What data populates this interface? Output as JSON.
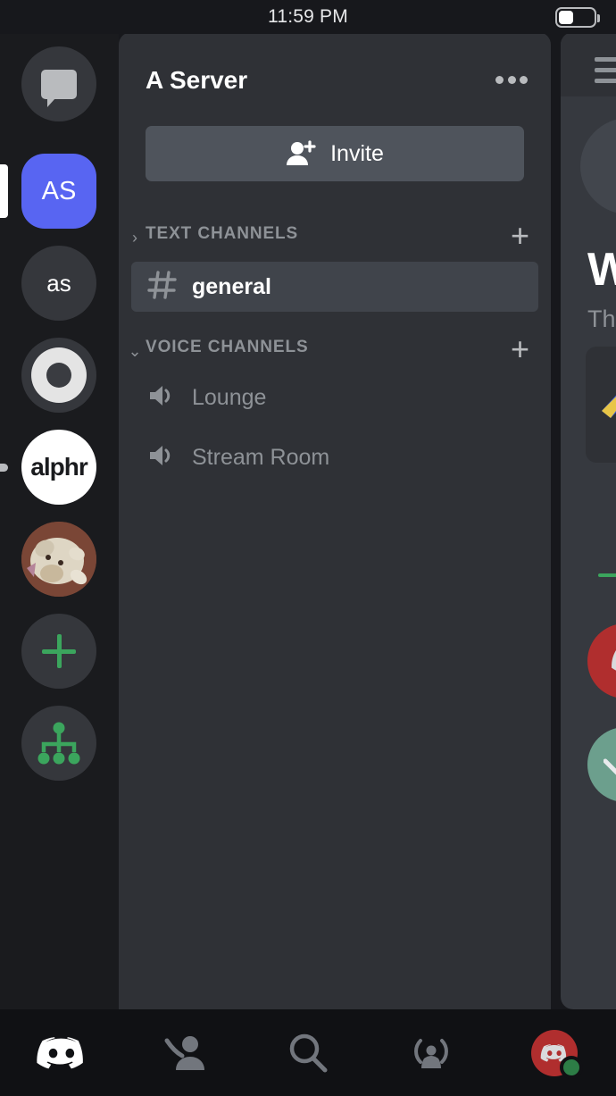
{
  "status_bar": {
    "time": "11:59 PM",
    "battery_icon": "battery-icon",
    "battery_level_percent": 38
  },
  "chat_panel": {
    "menu_icon": "hamburger-menu-icon",
    "welcome_heading": "W",
    "welcome_subtitle": "Th",
    "divider_color": "#3ba55d",
    "message_avatars": [
      "red-discord-avatar",
      "teal-avatar"
    ]
  },
  "server_rail": {
    "items": [
      {
        "name": "direct-messages",
        "type": "dm",
        "label": "",
        "icon": "chat-bubble-icon",
        "indicator": "none",
        "bg": "#35373c"
      },
      {
        "name": "server-as-active",
        "type": "text-squircle",
        "label": "AS",
        "icon": "",
        "indicator": "active",
        "bg": "#5865f2"
      },
      {
        "name": "server-as-lower",
        "type": "text",
        "label": "as",
        "icon": "",
        "indicator": "none",
        "bg": "#35373c"
      },
      {
        "name": "server-donut",
        "type": "donut",
        "label": "",
        "icon": "donut-logo-icon",
        "indicator": "none",
        "bg": "#35373c"
      },
      {
        "name": "server-alphr",
        "type": "white",
        "label": "alphr",
        "icon": "",
        "indicator": "unread",
        "bg": "#ffffff"
      },
      {
        "name": "server-dog-photo",
        "type": "photo",
        "label": "",
        "icon": "dog-photo-avatar",
        "indicator": "none",
        "bg": "#6b3f33"
      },
      {
        "name": "add-a-server",
        "type": "plus",
        "label": "",
        "icon": "plus-icon",
        "indicator": "none",
        "bg": "#35373c"
      },
      {
        "name": "explore-servers",
        "type": "explore",
        "label": "",
        "icon": "server-discovery-icon",
        "indicator": "none",
        "bg": "#35373c"
      }
    ],
    "accent_green": "#3ba55d",
    "blurple": "#5865f2"
  },
  "channel_panel": {
    "server_name": "A Server",
    "more_options_icon": "more-options-icon",
    "invite": {
      "label": "Invite",
      "icon": "person-add-icon"
    },
    "categories": [
      {
        "name": "TEXT CHANNELS",
        "chevron": "chevron-right-icon",
        "expanded": false,
        "add_icon": "plus-icon",
        "channels": [
          {
            "name": "general",
            "icon": "hash-icon",
            "active": true
          }
        ]
      },
      {
        "name": "VOICE CHANNELS",
        "chevron": "chevron-down-icon",
        "expanded": true,
        "add_icon": "plus-icon",
        "channels": [
          {
            "name": "Lounge",
            "icon": "speaker-icon",
            "active": false
          },
          {
            "name": "Stream Room",
            "icon": "speaker-icon",
            "active": false
          }
        ]
      }
    ]
  },
  "bottom_nav": {
    "items": [
      {
        "name": "nav-home",
        "icon": "discord-logo-icon",
        "active": true
      },
      {
        "name": "nav-friends",
        "icon": "friends-icon",
        "active": false
      },
      {
        "name": "nav-search",
        "icon": "search-icon",
        "active": false
      },
      {
        "name": "nav-mentions",
        "icon": "mentions-icon",
        "active": false
      },
      {
        "name": "nav-profile",
        "icon": "user-avatar-icon",
        "active": false
      }
    ],
    "profile_status": "online",
    "status_color": "#2d7d46"
  }
}
